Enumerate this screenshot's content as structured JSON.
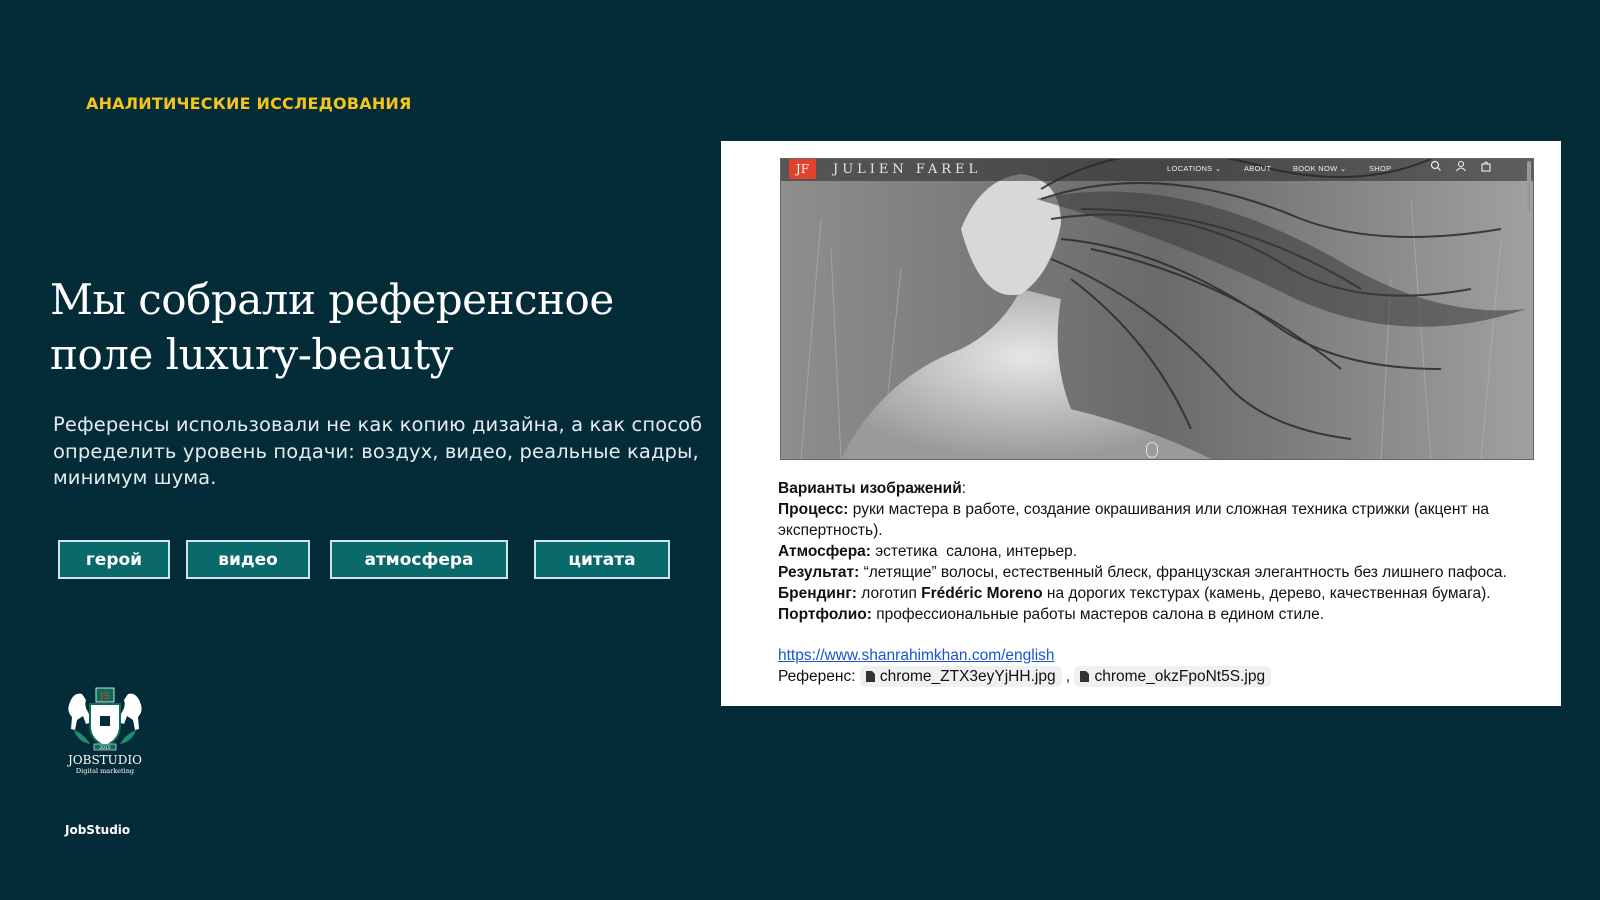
{
  "section_label": "АНАЛИТИЧЕСКИЕ ИССЛЕДОВАНИЯ",
  "headline": {
    "line1": "Мы собрали референсное",
    "line2": "поле luxury-beauty"
  },
  "lead": {
    "line1": "Референсы использовали не как копию дизайна, а как способ",
    "line2": "определить уровень подачи: воздух, видео, реальные кадры,",
    "line3": "минимум шума."
  },
  "tags": [
    "герой",
    "видео",
    "атмосфера",
    "цитата"
  ],
  "logo": {
    "name": "JOBSTUDIO",
    "tagline": "Digital marketing",
    "monogram": "JS",
    "year": "2015"
  },
  "footer_brand": "JobStudio",
  "reference_site": {
    "logo_mark": "JF",
    "name": "JULIEN FAREL",
    "nav": [
      "LOCATIONS ⌄",
      "ABOUT",
      "BOOK NOW ⌄",
      "SHOP"
    ],
    "icons": [
      "search-icon",
      "user-icon",
      "bag-icon"
    ]
  },
  "notes": {
    "title": "Варианты изображений",
    "title_suffix": ":",
    "items": [
      {
        "label": "Процесс:",
        "text": " руки мастера в работе, создание окрашивания или сложная техника стрижки (акцент на экспертность)."
      },
      {
        "label": "Атмосфера:",
        "text": " эстетика  салона, интерьер."
      },
      {
        "label": "Результат:",
        "text": " “летящие” волосы, естественный блеск, французская элегантность без лишнего пафоса."
      },
      {
        "label": "Брендинг:",
        "text_before": " логотип ",
        "highlight": "Frédéric Moreno",
        "text_after": " на дорогих текстурах (камень, дерево, качественная бумага)."
      },
      {
        "label": "Портфолио:",
        "text": " профессиональные работы мастеров салона в едином стиле."
      }
    ],
    "link": "https://www.shanrahimkhan.com/english",
    "ref_label": "Референс: ",
    "ref_files": [
      "chrome_ZTX3eyYjHH.jpg",
      "chrome_okzFpoNt5S.jpg"
    ],
    "ref_separator": " , "
  },
  "colors": {
    "background": "#032b38",
    "accent_yellow": "#f5c518",
    "tag_fill": "#0a6a6b",
    "link_blue": "#1a55c9"
  }
}
